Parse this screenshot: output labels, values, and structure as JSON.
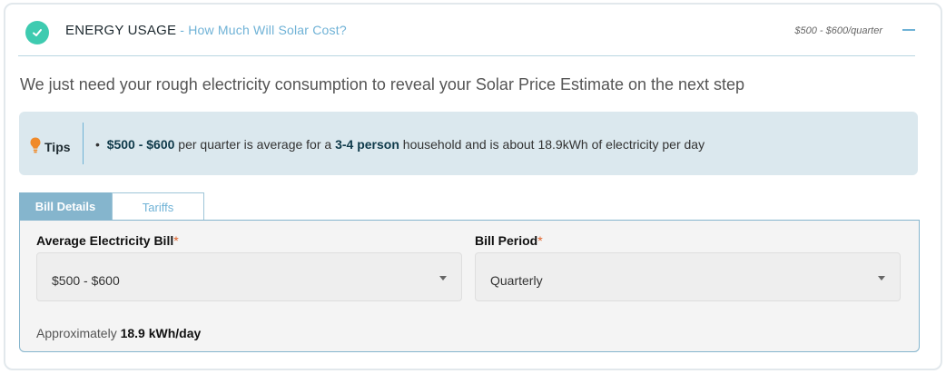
{
  "header": {
    "title": "ENERGY USAGE",
    "subtitle": " - How Much Will Solar Cost?",
    "summary": "$500 - $600/quarter"
  },
  "intro": "We just need your rough electricity consumption to reveal your Solar Price Estimate on the next step",
  "tips": {
    "label": "Tips",
    "bullet": "•",
    "range": "$500 - $600",
    "text_a": " per quarter is average for a ",
    "persons": "3-4 person",
    "text_b": " household and is about 18.9kWh of electricity per day"
  },
  "tabs": [
    {
      "label": "Bill Details",
      "active": true
    },
    {
      "label": "Tariffs",
      "active": false
    }
  ],
  "form": {
    "bill_label": "Average Electricity Bill",
    "bill_value": "$500 - $600",
    "period_label": "Bill Period",
    "period_value": "Quarterly",
    "required_mark": "*",
    "approx_prefix": "Approximately ",
    "approx_value": "18.9 kWh/day"
  },
  "colors": {
    "accent": "#6fb2d6",
    "check": "#3ecbb0",
    "tab_active": "#85b5cd",
    "required": "#e0622a",
    "bulb": "#f08a2a"
  },
  "icons": {
    "check": "check-icon",
    "bulb": "lightbulb-icon",
    "collapse": "minus-icon",
    "caret": "caret-down-icon"
  }
}
